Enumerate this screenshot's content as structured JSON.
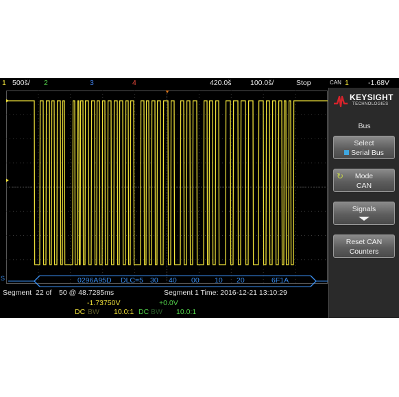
{
  "status_bar": {
    "ch1_num": "1",
    "ch1_scale": "500š/",
    "ch2_num": "2",
    "ch3_num": "3",
    "ch4_num": "4",
    "time_div": "420.0š",
    "time_offset": "100.0š/",
    "run_state": "Stop",
    "trigger_source": "CAN",
    "trigger_ch": "1",
    "trigger_level": "-1.68V"
  },
  "decode": {
    "id": "0296A95D",
    "dlc": "DLC=5",
    "bytes": [
      "30",
      "40",
      "00",
      "10",
      "20"
    ],
    "crc": "6F1A",
    "bus_label": "S"
  },
  "segment_info": {
    "label": "Segment",
    "index": "22 of",
    "count_time": "50 @ 48.7285ms",
    "seg1_time": "Segment 1 Time: 2016-12-21 13:10:29"
  },
  "readouts": {
    "ch1_offset": "-1.73750V",
    "ch2_offset": "+0.0V",
    "ch1_coupling": "DC",
    "ch1_bw": "BW",
    "ch1_probe": "10.0:1",
    "ch2_coupling": "DC",
    "ch2_bw": "BW",
    "ch2_probe": "10.0:1"
  },
  "panel": {
    "brand": "KEYSIGHT",
    "brand_sub": "TECHNOLOGIES",
    "title": "Bus",
    "softkeys": [
      {
        "line1": "Select",
        "line2": "Serial Bus"
      },
      {
        "line1": "Mode",
        "line2": "CAN"
      },
      {
        "line1": "Signals",
        "line2": ""
      },
      {
        "line1": "Reset CAN",
        "line2": "Counters"
      }
    ]
  },
  "colors": {
    "ch1": "#f0e23a",
    "ch2": "#52d14a",
    "ch3": "#3f7fe8",
    "ch4": "#e8483b",
    "decode": "#3a8ef0",
    "brand_red": "#d4232b"
  }
}
